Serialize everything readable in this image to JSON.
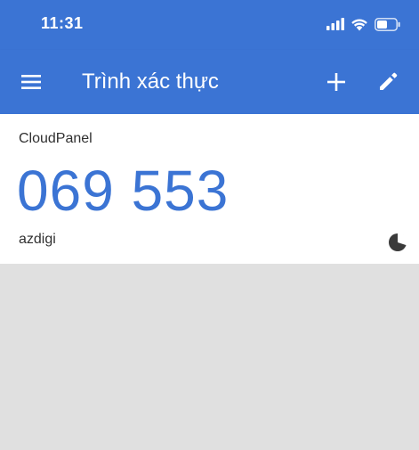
{
  "status_bar": {
    "time": "11:31",
    "icons": [
      "signal-icon",
      "wifi-icon",
      "battery-icon"
    ]
  },
  "app_bar": {
    "title": "Trình xác thực",
    "menu_icon": "menu-icon",
    "add_icon": "plus-icon",
    "edit_icon": "pencil-icon",
    "color": "#3b74d4"
  },
  "accounts": [
    {
      "issuer": "CloudPanel",
      "code": "069 553",
      "account": "azdigi",
      "code_color": "#3b74d4",
      "timer_remaining_fraction": 0.7
    }
  ],
  "colors": {
    "accent": "#3b74d4",
    "background": "#e0e0e0",
    "card": "#ffffff"
  }
}
